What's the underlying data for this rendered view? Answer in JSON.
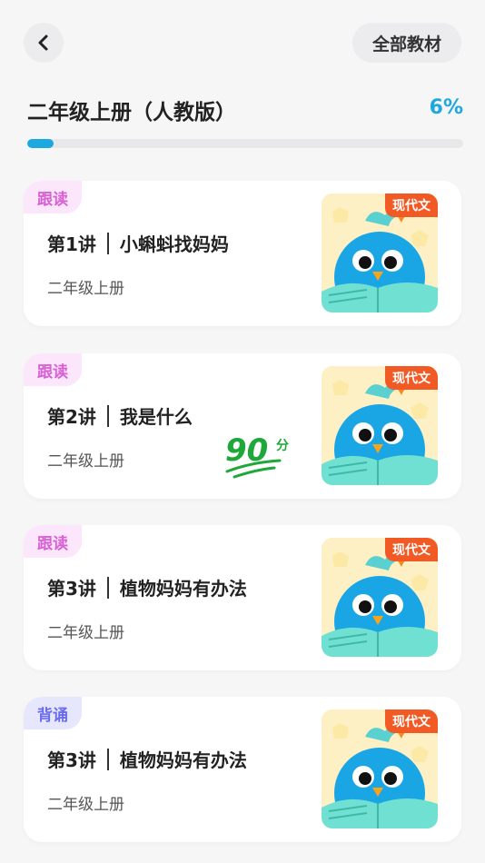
{
  "header": {
    "back_icon": "chevron-left-icon",
    "all_materials_label": "全部教材"
  },
  "book": {
    "title": "二年级上册（人教版）",
    "progress_text": "6%",
    "progress": 0.06,
    "accent_color": "#1ea8e0"
  },
  "lessons": [
    {
      "tag": "跟读",
      "tag_type": "read",
      "lesson_no": "第1讲",
      "lesson_name": "小蝌蚪找妈妈",
      "grade": "二年级上册",
      "thumb_badge": "现代文",
      "score": ""
    },
    {
      "tag": "跟读",
      "tag_type": "read",
      "lesson_no": "第2讲",
      "lesson_name": "我是什么",
      "grade": "二年级上册",
      "thumb_badge": "现代文",
      "score": "90",
      "score_unit": "分"
    },
    {
      "tag": "跟读",
      "tag_type": "read",
      "lesson_no": "第3讲",
      "lesson_name": "植物妈妈有办法",
      "grade": "二年级上册",
      "thumb_badge": "现代文",
      "score": ""
    },
    {
      "tag": "背诵",
      "tag_type": "recite",
      "lesson_no": "第3讲",
      "lesson_name": "植物妈妈有办法",
      "grade": "二年级上册",
      "thumb_badge": "现代文",
      "score": ""
    }
  ]
}
